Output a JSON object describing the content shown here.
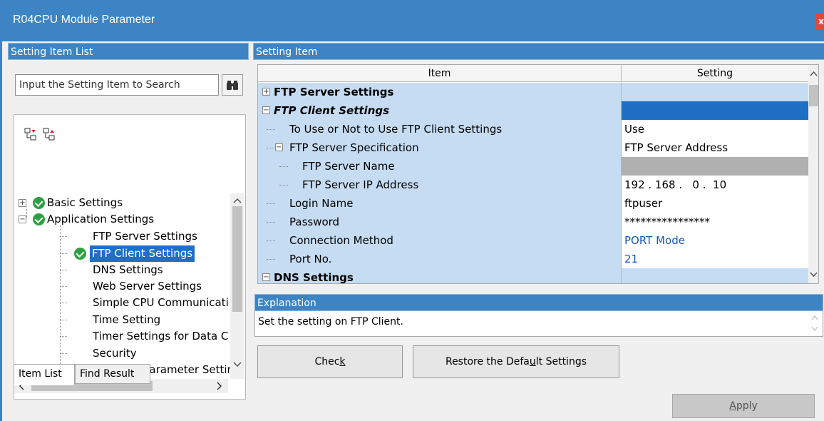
{
  "window": {
    "title": "R04CPU Module Parameter",
    "close_symbol": "x"
  },
  "left": {
    "header": "Setting Item List",
    "search_placeholder": "Input the Setting Item to Search",
    "tree": [
      {
        "label": "Basic Settings"
      },
      {
        "label": "Application Settings"
      },
      {
        "label": "FTP Server Settings"
      },
      {
        "label": "FTP Client Settings"
      },
      {
        "label": "DNS Settings"
      },
      {
        "label": "Web Server Settings"
      },
      {
        "label": "Simple CPU Communicati"
      },
      {
        "label": "Time Setting"
      },
      {
        "label": "Timer Settings for Data C"
      },
      {
        "label": "Security"
      },
      {
        "label": "Gateway Parameter Settir"
      }
    ],
    "tabs": {
      "item_list": "Item List",
      "find_result": "Find Result"
    }
  },
  "right": {
    "header": "Setting Item",
    "columns": {
      "item": "Item",
      "setting": "Setting"
    },
    "rows": [
      {
        "item": "FTP Server Settings",
        "setting": ""
      },
      {
        "item": "FTP Client Settings",
        "setting": ""
      },
      {
        "item": "To Use or Not to Use FTP Client Settings",
        "setting": "Use"
      },
      {
        "item": "FTP Server Specification",
        "setting": "FTP Server Address"
      },
      {
        "item": "FTP Server Name",
        "setting": ""
      },
      {
        "item": "FTP Server IP Address",
        "setting": "192 . 168 .   0 .  10"
      },
      {
        "item": "Login Name",
        "setting": "ftpuser"
      },
      {
        "item": "Password",
        "setting": "****************"
      },
      {
        "item": "Connection Method",
        "setting": "PORT Mode"
      },
      {
        "item": "Port No.",
        "setting": "21"
      },
      {
        "item": "DNS Settings",
        "setting": ""
      }
    ],
    "explanation_header": "Explanation",
    "explanation_text": "Set the setting on FTP Client."
  },
  "buttons": {
    "check_pre": "Chec",
    "check_underlined": "k",
    "check_post": "",
    "restore_pre": "Restore the Defa",
    "restore_underlined": "u",
    "restore_post": "lt Settings",
    "apply_pre": "",
    "apply_underlined": "A",
    "apply_post": "pply"
  },
  "icons": {
    "search": "binoculars-icon",
    "expand_all": "expand-all-icon",
    "collapse_all": "collapse-all-icon",
    "setting_done": "check-circle-icon"
  },
  "colors": {
    "accent": "#3c84c4",
    "selection": "#1f6fc5",
    "row_highlight": "#c6dcf2",
    "check_green": "#2ea043",
    "link_value": "#1a58b5"
  }
}
